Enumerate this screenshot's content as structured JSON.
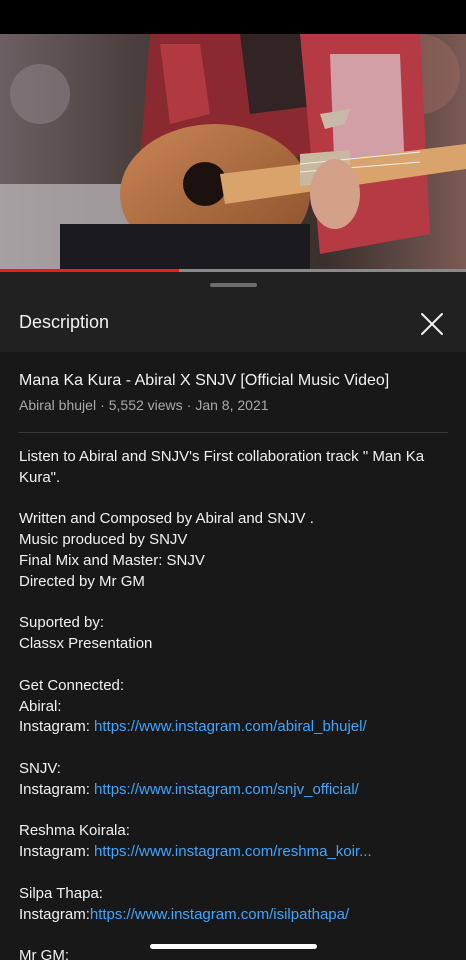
{
  "player": {
    "progress": 0.385
  },
  "sheet": {
    "title": "Description"
  },
  "video": {
    "title": "Mana Ka Kura - Abiral X SNJV [Official Music Video]",
    "channel": "Abiral bhujel",
    "views": "5,552 views",
    "date": "Jan 8, 2021"
  },
  "description": {
    "intro_line1": "Listen to Abiral and SNJV's First collaboration track \" Man Ka",
    "intro_line2": "Kura\".",
    "credits": [
      "Written and Composed by Abiral and SNJV .",
      "Music produced by SNJV",
      "Final Mix and Master: SNJV",
      "Directed by Mr GM"
    ],
    "supported_label": "Suported by:",
    "supported_by": "Classx Presentation",
    "connected_label": "Get Connected:",
    "abiral_label": "Abiral:",
    "abiral_ig_prefix": "Instagram: ",
    "abiral_ig_link": "https://www.instagram.com/abiral_bhujel/",
    "snjv_label": "SNJV:",
    "snjv_ig_prefix": "Instagram: ",
    "snjv_ig_link": "https://www.instagram.com/snjv_official/",
    "reshma_label": "Reshma Koirala:",
    "reshma_ig_prefix": "Instagram: ",
    "reshma_ig_link": "https://www.instagram.com/reshma_koir...",
    "silpa_label": "Silpa Thapa:",
    "silpa_ig_prefix": "Instagram:",
    "silpa_ig_link": "https://www.instagram.com/isilpathapa/",
    "mrgm_label": "Mr GM:"
  },
  "colors": {
    "accent_red": "#e62117",
    "link_blue": "#3ea6ff",
    "sheet_bg": "#212121",
    "content_bg": "#181818"
  },
  "icons": {
    "close": "close-icon"
  }
}
